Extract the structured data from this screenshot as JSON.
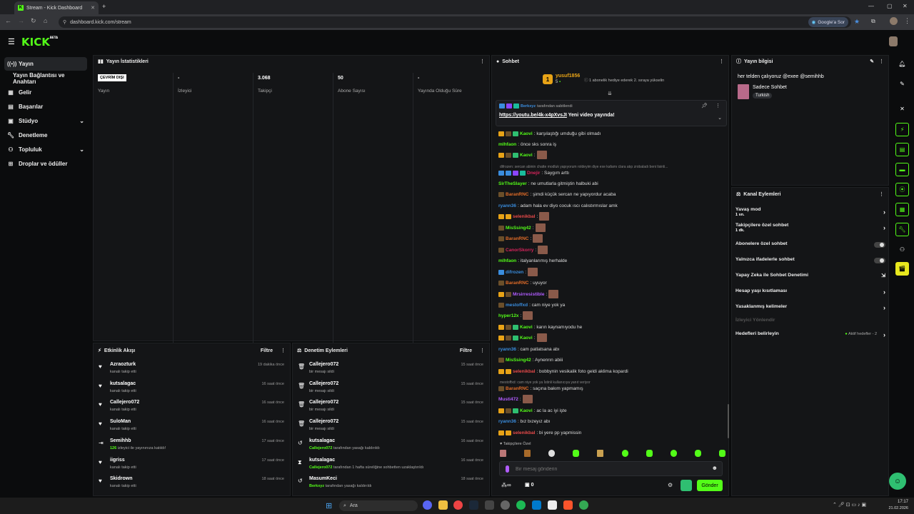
{
  "browser": {
    "tab_title": "Stream - Kick Dashboard",
    "url": "dashboard.kick.com/stream",
    "google_pill": "Google'a Sor"
  },
  "brand": {
    "logo": "KICK",
    "logo_sup": "BETA",
    "accent": "#53fc18"
  },
  "sidebar": {
    "items": [
      {
        "label": "Yayın",
        "icon": "broadcast-icon",
        "active": true
      },
      {
        "label": "Yayın Bağlantısı ve Anahtarı"
      },
      {
        "label": "Gelir",
        "icon": "revenue-icon"
      },
      {
        "label": "Başarılar",
        "icon": "achievements-icon"
      },
      {
        "label": "Stüdyo",
        "icon": "studio-icon",
        "expandable": true
      },
      {
        "label": "Denetleme",
        "icon": "wrench-icon"
      },
      {
        "label": "Topluluk",
        "icon": "community-icon",
        "expandable": true
      },
      {
        "label": "Droplar ve ödüller",
        "icon": "gift-icon"
      }
    ]
  },
  "stats": {
    "title": "Yayın İstatistikleri",
    "offline_badge": "ÇEVRİM DIŞI",
    "columns": [
      {
        "value": "",
        "label": "Yayın"
      },
      {
        "value": "-",
        "label": "İzleyici"
      },
      {
        "value": "3.068",
        "label": "Takipçi"
      },
      {
        "value": "50",
        "label": "Abone Sayısı"
      },
      {
        "value": "-",
        "label": "Yayında Olduğu Süre"
      }
    ]
  },
  "activity": {
    "title": "Etkinlik Akışı",
    "filter": "Filtre",
    "rows": [
      {
        "name": "Azraozturk",
        "sub": "kanalı takip etti",
        "time": "19 dakika önce",
        "icon": "heart-icon"
      },
      {
        "name": "kutsalagac",
        "sub": "kanalı takip etti",
        "time": "16 saat önce",
        "icon": "heart-icon"
      },
      {
        "name": "Callejero072",
        "sub": "kanalı takip etti",
        "time": "16 saat önce",
        "icon": "heart-icon"
      },
      {
        "name": "SuloMan",
        "sub": "kanalı takip etti",
        "time": "16 saat önce",
        "icon": "heart-icon"
      },
      {
        "name": "Semihhb",
        "sub_highlight": "126",
        "sub": "izleyici ile yayınınıza katıldı!",
        "time": "17 saat önce",
        "icon": "raid-icon"
      },
      {
        "name": "iigriss",
        "sub": "kanalı takip etti",
        "time": "17 saat önce",
        "icon": "heart-icon"
      },
      {
        "name": "Skidrown",
        "sub": "kanalı takip etti",
        "time": "18 saat önce",
        "icon": "heart-icon"
      }
    ]
  },
  "moderation": {
    "title": "Denetim Eylemleri",
    "filter": "Filtre",
    "rows": [
      {
        "name": "Callejero072",
        "sub": "bir mesajı sildi",
        "time": "15 saat önce",
        "icon": "trash-icon"
      },
      {
        "name": "Callejero072",
        "sub": "bir mesajı sildi",
        "time": "15 saat önce",
        "icon": "trash-icon"
      },
      {
        "name": "Callejero072",
        "sub": "bir mesajı sildi",
        "time": "15 saat önce",
        "icon": "trash-icon"
      },
      {
        "name": "Callejero072",
        "sub": "bir mesajı sildi",
        "time": "15 saat önce",
        "icon": "trash-icon"
      },
      {
        "name": "kutsalagac",
        "sub_highlight": "Callejero072",
        "sub": "tarafından yasağı kaldırıldı",
        "time": "16 saat önce",
        "icon": "undo-icon"
      },
      {
        "name": "kutsalagac",
        "sub_highlight": "Callejero072",
        "sub": "tarafından 1 hafta süreliğine sohbetten uzaklaştırıldı",
        "time": "16 saat önce",
        "icon": "hourglass-icon"
      },
      {
        "name": "MasumKeci",
        "sub_highlight": "Berkxyz",
        "sub": "tarafından yasağı kaldırıldı",
        "time": "18 saat önce",
        "icon": "undo-icon"
      }
    ]
  },
  "chat": {
    "title": "Sohbet",
    "gift_user": "yusuf1856",
    "gift_count": "5",
    "gift_text": "1 abonelik hediye ederek 2. sıraya yükselin",
    "pinned_by": "Berkxyz",
    "pinned_suffix": "tarafından sabitlendi",
    "pinned_link": "https://youtu.be/4k-x4pXvsJI",
    "pinned_text": "Yeni video yayında!",
    "messages": [
      {
        "user": "Kaovi",
        "color": "#53fc18",
        "text": ": karşılaştığı umduğu gibi olmadı",
        "badges": [
          "#e8a317",
          "#6b4f2a",
          "#2fbf71"
        ]
      },
      {
        "user": "mlhfaon",
        "color": "#53fc18",
        "text": ": önce sks sonra iş"
      },
      {
        "user": "Kaovi",
        "color": "#53fc18",
        "text": ":",
        "emote": true,
        "badges": [
          "#e8a317",
          "#6b4f2a",
          "#2fbf71"
        ]
      },
      {
        "system": "difrozen: sercan abinin chatte modluk yapıyorum roldeyim diye exe kafamı clara atıp zrobaladı beni lisinli..."
      },
      {
        "user": "Dnejir",
        "color": "#d6245b",
        "text": ": Saygım arttı",
        "badges": [
          "#3a8dde",
          "#3a8dde",
          "#8b45ff",
          "#1abc9c"
        ]
      },
      {
        "user": "SirTheSlayer",
        "color": "#53fc18",
        "text": ": ne umutlarla gitmiştin halbuki abi"
      },
      {
        "user": "BaranRNC",
        "color": "#e06c28",
        "text": ": şimdi küçük sercan ne yapıyordur acaba",
        "badges": [
          "#6b4f2a"
        ]
      },
      {
        "user": "ryann36",
        "color": "#3a8dde",
        "text": ": adam hala ev diyo cocuk ıscı calıstırmıslar amk"
      },
      {
        "user": "selenikbal",
        "color": "#e84a4a",
        "text": ":",
        "emote": true,
        "badges": [
          "#e8a317",
          "#e8a317"
        ]
      },
      {
        "user": "MisSsing42",
        "color": "#53fc18",
        "text": ":",
        "emote": true,
        "badges": [
          "#6b4f2a"
        ]
      },
      {
        "user": "BaranRNC",
        "color": "#e06c28",
        "text": ":",
        "emote": true,
        "badges": [
          "#6b4f2a"
        ]
      },
      {
        "user": "CanorSkorry",
        "color": "#d6245b",
        "text": ":",
        "emote": true,
        "badges": [
          "#6b4f2a"
        ]
      },
      {
        "user": "mlhfaon",
        "color": "#53fc18",
        "text": ": italyanlarımış herhalde"
      },
      {
        "user": "difrozen",
        "color": "#3a8dde",
        "text": ":",
        "emote": true,
        "badges": [
          "#3a8dde"
        ]
      },
      {
        "user": "BaranRNC",
        "color": "#e06c28",
        "text": ": uyuyor",
        "badges": [
          "#6b4f2a"
        ]
      },
      {
        "user": "Mrsirresistible",
        "color": "#b15cff",
        "text": ":",
        "emote": true,
        "badges": [
          "#e8a317",
          "#6b4f2a"
        ]
      },
      {
        "user": "mestoffxd",
        "color": "#3a8dde",
        "text": ": cam niye yok ya",
        "badges": [
          "#6b4f2a"
        ]
      },
      {
        "user": "hyper12x",
        "color": "#53fc18",
        "text": ":",
        "emote": true
      },
      {
        "user": "Kaovi",
        "color": "#53fc18",
        "text": ": karın kaynamıyodu he",
        "badges": [
          "#e8a317",
          "#6b4f2a",
          "#2fbf71"
        ]
      },
      {
        "user": "Kaovi",
        "color": "#53fc18",
        "text": ":",
        "emote": true,
        "badges": [
          "#e8a317",
          "#6b4f2a",
          "#2fbf71"
        ]
      },
      {
        "user": "ryann36",
        "color": "#3a8dde",
        "text": ": cam patlatsana abı"
      },
      {
        "user": "MisSsing42",
        "color": "#53fc18",
        "text": ": Aynenrın abiii",
        "badges": [
          "#6b4f2a"
        ]
      },
      {
        "user": "selenikbal",
        "color": "#e84a4a",
        "text": ": bobbynin vesikalik foto geldi aklima kopardi",
        "badges": [
          "#e8a317",
          "#e8a317"
        ]
      },
      {
        "system": "mestoffxd: cam niye yok ya İstinli kullanıcıya yanıt veriyor"
      },
      {
        "user": "BaranRNC",
        "color": "#e06c28",
        "text": ": saçına bakım yapmamış",
        "badges": [
          "#6b4f2a"
        ]
      },
      {
        "user": "Musti472",
        "color": "#b15cff",
        "text": ":",
        "emote": true
      },
      {
        "user": "Kaovi",
        "color": "#53fc18",
        "text": ": ac la ac iyi işte",
        "badges": [
          "#e8a317",
          "#6b4f2a",
          "#2fbf71"
        ]
      },
      {
        "user": "ryann36",
        "color": "#3a8dde",
        "text": ": bız bızeyız abı"
      },
      {
        "user": "selenikbal",
        "color": "#e84a4a",
        "text": ": bi yere pp yapmissin",
        "badges": [
          "#e8a317",
          "#e8a317"
        ]
      }
    ],
    "followers_only": "Takipçilere Özel",
    "input_placeholder": "Bir mesaj gönderin",
    "points": "0",
    "send_label": "Gönder"
  },
  "stream_info": {
    "title": "Yayın bilgisi",
    "stream_title": "her telden çalıyoruz @exee @semihhb",
    "category": "Sadece Sohbet",
    "tag": "Turkish"
  },
  "channel_actions": {
    "title": "Kanal Eylemleri",
    "items": [
      {
        "label": "Yavaş mod",
        "sub": "1 sn.",
        "control": "chevron"
      },
      {
        "label": "Takipçilere özel sohbet",
        "sub": "1 dk.",
        "control": "chevron"
      },
      {
        "label": "Abonelere özel sohbet",
        "control": "toggle"
      },
      {
        "label": "Yalnızca ifadelerle sohbet",
        "control": "toggle"
      },
      {
        "label": "Yapay Zeka ile Sohbet Denetimi",
        "control": "external"
      },
      {
        "label": "Hesap yaşı kısıtlaması",
        "control": "chevron"
      },
      {
        "label": "Yasaklanmış kelimeler",
        "control": "chevron"
      },
      {
        "label": "İzleyici Yönlendir",
        "control": "none",
        "disabled": true
      },
      {
        "label": "Hedefleri belirleyin",
        "status": "Aktif hedefler - 2",
        "control": "chevron"
      }
    ]
  },
  "taskbar": {
    "search": "Ara",
    "time": "17:17",
    "date": "21.02.2026"
  }
}
